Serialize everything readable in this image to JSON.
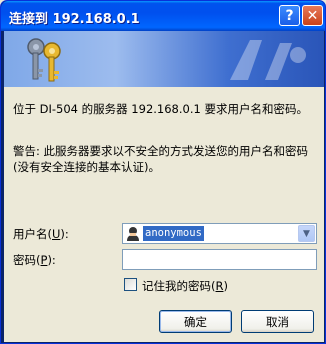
{
  "window": {
    "title": "连接到 192.168.0.1",
    "help_glyph": "?",
    "close_glyph": "✕"
  },
  "message": "位于 DI-504 的服务器 192.168.0.1 要求用户名和密码。",
  "warning": "警告: 此服务器要求以不安全的方式发送您的用户名和密码(没有安全连接的基本认证)。",
  "form": {
    "username_label": "用户名",
    "username_hotkey": "U",
    "username_value": "anonymous",
    "password_label": "密码",
    "password_hotkey": "P",
    "password_value": "",
    "remember_label": "记住我的密码",
    "remember_hotkey": "R",
    "remember_checked": false
  },
  "buttons": {
    "ok": "确定",
    "cancel": "取消"
  },
  "icons": {
    "title_help": "help-icon",
    "title_close": "close-icon",
    "banner": "keys-icon",
    "user": "user-icon",
    "dropdown": "chevron-down-icon"
  },
  "colors": {
    "titlebar": "#0053ee",
    "dialog_bg": "#ece9d8",
    "selection": "#316ac5"
  }
}
